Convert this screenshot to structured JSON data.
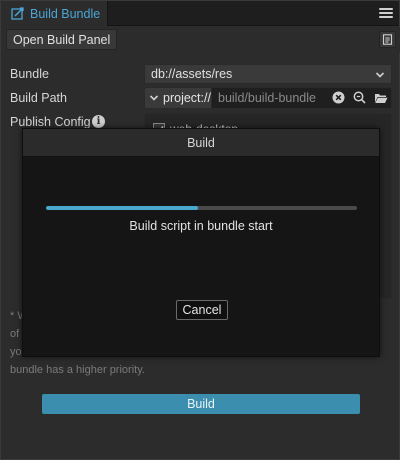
{
  "tab": {
    "label": "Build Bundle",
    "icon": "build-bundle-icon"
  },
  "toolbar": {
    "open_build_panel_label": "Open Build Panel",
    "doc_icon": "document-icon"
  },
  "form": {
    "bundle": {
      "label": "Bundle",
      "value": "db://assets/res"
    },
    "build_path": {
      "label": "Build Path",
      "protocol": "project://",
      "value": "build/build-bundle"
    },
    "publish_config": {
      "label": "Publish Config",
      "option_label": "web-desktop",
      "option_checked": true
    }
  },
  "note": {
    "line1": "* W",
    "line2": "of",
    "line3": "yo",
    "line4": "bundle has a higher priority."
  },
  "build_button": {
    "label": "Build"
  },
  "modal": {
    "title": "Build",
    "status": "Build script in bundle start",
    "progress": 0.49,
    "cancel_label": "Cancel"
  },
  "colors": {
    "accent": "#4aa6d6",
    "primary_button": "#3b8eae",
    "progress_fill": "#4aa6cc"
  }
}
